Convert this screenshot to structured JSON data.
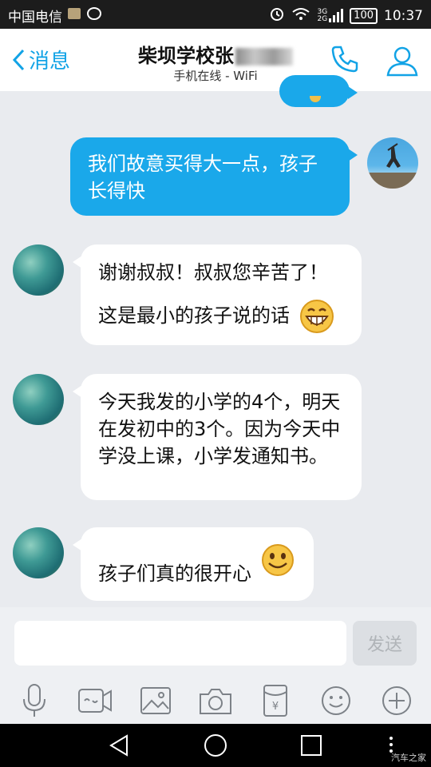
{
  "status_bar": {
    "carrier": "中国电信",
    "network_labels": [
      "3G",
      "2G"
    ],
    "battery": "100",
    "time": "10:37"
  },
  "header": {
    "back_label": "消息",
    "title": "柴坝学校张",
    "subtitle": "手机在线 - WiFi"
  },
  "messages": [
    {
      "side": "out",
      "text": "我们故意买得大一点，孩子长得快"
    },
    {
      "side": "in",
      "text_line1": "谢谢叔叔！叔叔您辛苦了！",
      "text_line2": "这是最小的孩子说的话"
    },
    {
      "side": "in",
      "text": "今天我发的小学的4个，明天在发初中的3个。因为今天中学没上课，小学发通知书。"
    },
    {
      "side": "in",
      "text": "孩子们真的很开心"
    }
  ],
  "input": {
    "value": "",
    "send_label": "发送"
  },
  "toolbar": {
    "tools": [
      "microphone-icon",
      "video-icon",
      "image-icon",
      "camera-icon",
      "red-packet-icon",
      "emoji-icon",
      "plus-icon"
    ]
  },
  "watermark": "汽车之家",
  "colors": {
    "accent": "#12a3e6",
    "outgoing_bubble": "#1aa8ea",
    "background": "#e9ebef"
  }
}
